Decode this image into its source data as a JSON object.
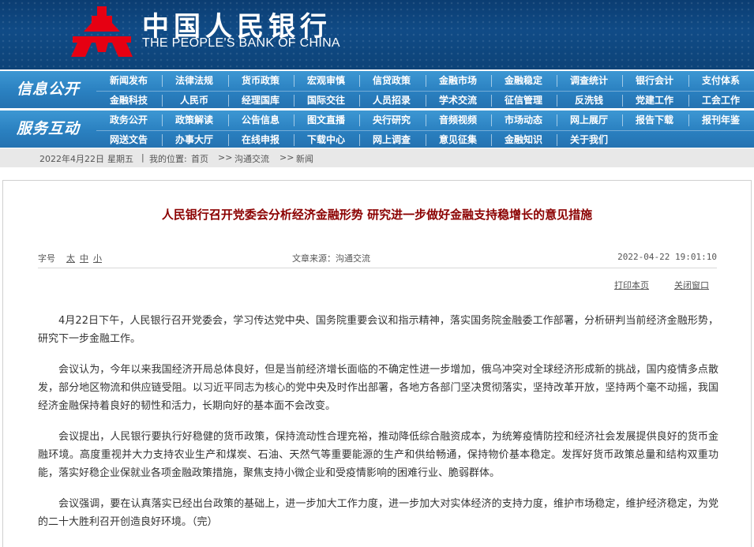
{
  "header": {
    "title_cn": "中国人民银行",
    "title_en": "THE PEOPLE'S BANK OF CHINA",
    "logo_icon": "pboc-emblem-icon",
    "logo_color": "#e60012",
    "bg_color": "#0d4378"
  },
  "nav": {
    "info": {
      "label": "信息公开",
      "row1": [
        "新闻发布",
        "法律法规",
        "货币政策",
        "宏观审慎",
        "信贷政策",
        "金融市场",
        "金融稳定",
        "调查统计",
        "银行会计",
        "支付体系"
      ],
      "row2": [
        "金融科技",
        "人民币",
        "经理国库",
        "国际交往",
        "人员招录",
        "学术交流",
        "征信管理",
        "反洗钱",
        "党建工作",
        "工会工作"
      ]
    },
    "service": {
      "label": "服务互动",
      "row1": [
        "政务公开",
        "政策解读",
        "公告信息",
        "图文直播",
        "央行研究",
        "音频视频",
        "市场动态",
        "网上展厅",
        "报告下载",
        "报刊年鉴"
      ],
      "row2": [
        "网送文告",
        "办事大厅",
        "在线申报",
        "下载中心",
        "网上调查",
        "意见征集",
        "金融知识",
        "关于我们"
      ]
    },
    "bar_color": "#2a80c0"
  },
  "breadcrumb": {
    "date": "2022年4月22日",
    "weekday": "星期五",
    "sep": "|",
    "location_label": "我的位置:",
    "home": "首页",
    "arrow1": ">>",
    "section": "沟通交流",
    "arrow2": ">>",
    "current": "新闻"
  },
  "article": {
    "title": "人民银行召开党委会分析经济金融形势 研究进一步做好金融支持稳增长的意见措施",
    "title_color": "#8b0000",
    "font_size_label": "字号",
    "font_sizes": [
      "太",
      "中",
      "小"
    ],
    "source": "文章来源：沟通交流",
    "datetime": "2022-04-22 19:01:10",
    "print_label": "打印本页",
    "close_label": "关闭窗口",
    "paragraphs": [
      "4月22日下午，人民银行召开党委会，学习传达党中央、国务院重要会议和指示精神，落实国务院金融委工作部署，分析研判当前经济金融形势，研究下一步金融工作。",
      "会议认为，今年以来我国经济开局总体良好，但是当前经济增长面临的不确定性进一步增加，俄乌冲突对全球经济形成新的挑战，国内疫情多点散发，部分地区物流和供应链受阻。以习近平同志为核心的党中央及时作出部署，各地方各部门坚决贯彻落实，坚持改革开放，坚持两个毫不动摇，我国经济金融保持着良好的韧性和活力，长期向好的基本面不会改变。",
      "会议提出，人民银行要执行好稳健的货币政策，保持流动性合理充裕，推动降低综合融资成本，为统筹疫情防控和经济社会发展提供良好的货币金融环境。高度重视并大力支持农业生产和煤炭、石油、天然气等重要能源的生产和供给畅通，保持物价基本稳定。发挥好货币政策总量和结构双重功能，落实好稳企业保就业各项金融政策措施，聚焦支持小微企业和受疫情影响的困难行业、脆弱群体。",
      "会议强调，要在认真落实已经出台政策的基础上，进一步加大工作力度，进一步加大对实体经济的支持力度，维护市场稳定，维护经济稳定，为党的二十大胜利召开创造良好环境。（完）"
    ]
  }
}
